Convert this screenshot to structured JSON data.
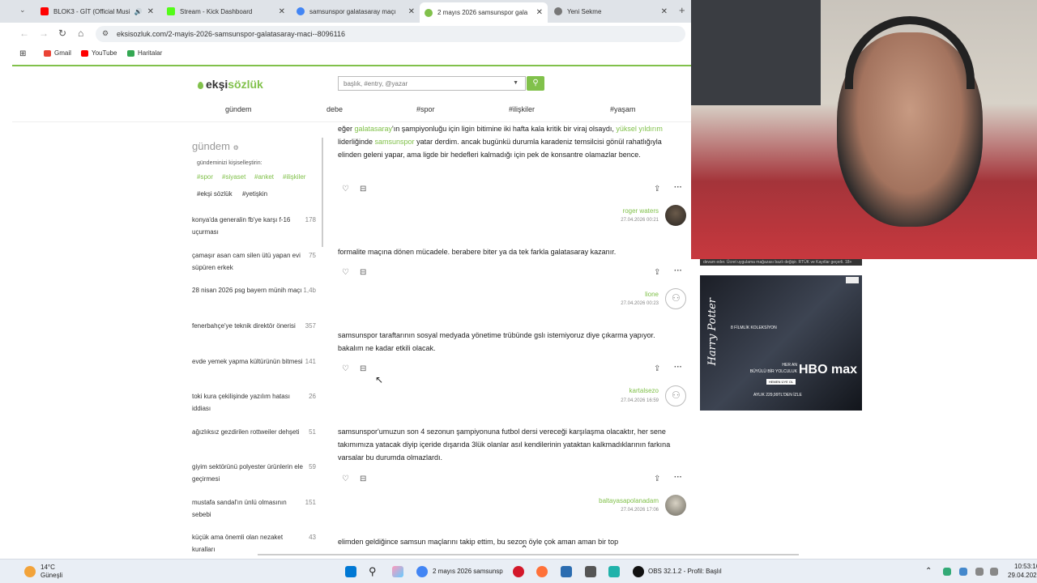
{
  "browser": {
    "tabs": [
      {
        "title": "BLOK3 - GİT (Official Music",
        "favicon_color": "#ff0000"
      },
      {
        "title": "Stream - Kick Dashboard",
        "favicon_color": "#53fc18"
      },
      {
        "title": "samsunspor galatasaray maçı",
        "favicon_color": "#4285f4"
      },
      {
        "title": "2 mayıs 2026 samsunspor gala",
        "favicon_color": "#81c14b"
      },
      {
        "title": "Yeni Sekme",
        "favicon_color": "#777777"
      }
    ],
    "url": "eksisozluk.com/2-mayis-2026-samsunspor-galatasaray-maci--8096116",
    "bookmarks": [
      "Gmail",
      "YouTube",
      "Haritalar"
    ]
  },
  "site": {
    "logo_a": "ekşi",
    "logo_b": "sözlük",
    "search_placeholder": "başlık, #entry, @yazar",
    "nav": [
      "gündem",
      "debe",
      "#spor",
      "#ilişkiler",
      "#yaşam"
    ]
  },
  "sidebar": {
    "title": "gündem",
    "personalize": "gündeminizi kişiselleştirin:",
    "tags_green": [
      "#spor",
      "#siyaset",
      "#anket",
      "#ilişkiler"
    ],
    "tags_dark": [
      "#ekşi sözlük",
      "#yetişkin"
    ],
    "items": [
      {
        "title": "konya'da generalin fb'ye karşı f-16 uçurması",
        "count": "178"
      },
      {
        "title": "çamaşır asan cam silen ütü yapan evi süpüren erkek",
        "count": "75"
      },
      {
        "title": "28 nisan 2026 psg bayern münih maçı",
        "count": "1,4b"
      },
      {
        "title": "fenerbahçe'ye teknik direktör önerisi",
        "count": "357"
      },
      {
        "title": "evde yemek yapma kültürünün bitmesi",
        "count": "141"
      },
      {
        "title": "toki kura çekilişinde yazılım hatası iddiası",
        "count": "26"
      },
      {
        "title": "ağızlıksız gezdirilen rottweiler dehşeti",
        "count": "51"
      },
      {
        "title": "giyim sektörünü polyester ürünlerin ele geçirmesi",
        "count": "59"
      },
      {
        "title": "mustafa sandal'ın ünlü olmasının sebebi",
        "count": "151"
      },
      {
        "title": "küçük ama önemli olan nezaket kuralları",
        "count": "43"
      }
    ]
  },
  "entries": [
    {
      "parts": [
        {
          "t": "eğer "
        },
        {
          "t": "galatasaray",
          "link": true
        },
        {
          "t": "'ın şampiyonluğu için ligin bitimine iki hafta kala kritik bir viraj olsaydı, "
        },
        {
          "t": "yüksel yıldırım",
          "link": true
        },
        {
          "t": " liderliğinde "
        },
        {
          "t": "samsunspor",
          "link": true
        },
        {
          "t": " yatar derdim. ancak bugünkü durumla karadeniz temsilcisi gönül rahatlığıyla elinden geleni yapar, ama ligde bir hedefleri kalmadığı için pek de konsantre olamazlar bence."
        }
      ],
      "author": "roger waters",
      "date": "27.04.2026 00:21"
    },
    {
      "parts": [
        {
          "t": "formalite maçına dönen mücadele. berabere biter ya da tek farkla galatasaray kazanır."
        }
      ],
      "author": "lione",
      "date": "27.04.2026 00:23"
    },
    {
      "parts": [
        {
          "t": "samsunspor taraftarının sosyal medyada yönetime trübünde gslı istemiyoruz diye çıkarma yapıyor. bakalım ne kadar etkili olacak."
        }
      ],
      "author": "kartalsezo",
      "date": "27.04.2026 16:59"
    },
    {
      "parts": [
        {
          "t": "samsunspor'umuzun son 4 sezonun şampiyonuna futbol dersi vereceği karşılaşma olacaktır, her sene takımımıza yatacak diyip içeride dışarıda 3lük olanlar asıl kendilerinin yataktan kalkmadıklarının farkına varsalar bu durumda olmazlardı."
        }
      ],
      "author": "baltayasapolanadam",
      "date": "27.04.2026 17:06"
    },
    {
      "parts": [
        {
          "t": "elimden geldiğince samsun maçlarını takip ettim, bu sezon öyle çok aman aman bir top"
        }
      ],
      "author": "",
      "date": ""
    }
  ],
  "ad": {
    "title": "Harry Potter",
    "subtitle": "8 FİLMLİK KOLEKSİYON",
    "tag1": "HER AN",
    "tag2": "BÜYÜLÜ BİR YOLCULUK",
    "cta": "HEMEN ÜYE OL",
    "brand": "HBO max",
    "price": "AYLIK 229,99TL'DEN İZLE",
    "strip_text": "devam eder. Ücret uygulama mağazası bazlı değişir. RTÜK ve Kayıtlar geçerli. 18+"
  },
  "taskbar": {
    "weather_temp": "14°C",
    "weather_desc": "Güneşli",
    "active_app": "2 mayıs 2026 samsunsp",
    "obs": "OBS 32.1.2 - Profil: Başlıl",
    "time": "10:53:16",
    "date": "29.04.2026"
  }
}
